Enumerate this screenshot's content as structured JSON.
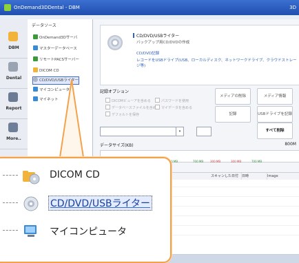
{
  "window": {
    "title": "OnDemand3DDental - DBM",
    "right_text": "3D"
  },
  "nav": [
    {
      "label": "DBM",
      "icon": "folder-icon",
      "color": "#f2b33b"
    },
    {
      "label": "Dental",
      "icon": "tooth-icon",
      "color": "#9aa3b2"
    },
    {
      "label": "Report",
      "icon": "report-icon",
      "color": "#6a7b93"
    },
    {
      "label": "More..",
      "icon": "more-icon",
      "color": "#6f7f97"
    }
  ],
  "tree": {
    "header": "データソース",
    "items": [
      {
        "label": "OnDemand3Dサーバ",
        "color": "#3a9b3a"
      },
      {
        "label": "マスターデータベース",
        "color": "#3a8bd6"
      },
      {
        "label": "リモートPACSサーバー",
        "color": "#3a9b3a"
      },
      {
        "label": "DICOM CD",
        "color": "#f2b33b"
      },
      {
        "label": "CD/DVD/USBライター",
        "color": "#aab4c4"
      },
      {
        "label": "マイコンピュータ",
        "color": "#3a8bd6"
      },
      {
        "label": "マイネット",
        "color": "#3a8bd6"
      }
    ]
  },
  "info": {
    "title": "CD/DVD/USBライター",
    "subtitle": "バックアップ用CD/DVDの作成",
    "bullet1": "CD/DVD記録",
    "bullet2": "レコードをUSBドライブ(USB、ローカルディスク、ネットワークドライブ、クラウドストレージ等)"
  },
  "record_options": {
    "title": "記録オプション",
    "options": [
      "DICOMビューアを含める",
      "データベースファイルを含める",
      "デフォルトを保存",
      "パスワードを使用",
      "マイデータを含める"
    ]
  },
  "buttons": {
    "delete_media": "メディアの削除",
    "media_info": "メディア情報",
    "record": "記録",
    "usb_record": "USBドライブを記録",
    "delete_all": "すべて削除"
  },
  "combo": {
    "value": "",
    "speed": ""
  },
  "db_size": {
    "label": "データサイズ(KB)",
    "right_label": "800M"
  },
  "size_ticks": [
    "700 MB",
    "300 MB",
    "700 MB",
    "700 MB",
    "300 MB",
    "300 MB",
    "700 MB"
  ],
  "table": {
    "col_scan_date": "スキャンした日付",
    "col_date": "日時",
    "col_image": "Image"
  },
  "zoom": {
    "items": [
      {
        "label": "DICOM CD",
        "icon": "folder-disc-icon"
      },
      {
        "label": "CD/DVD/USBライター",
        "icon": "disc-icon",
        "selected": true
      },
      {
        "label": "マイコンピュータ",
        "icon": "computer-icon"
      }
    ]
  }
}
